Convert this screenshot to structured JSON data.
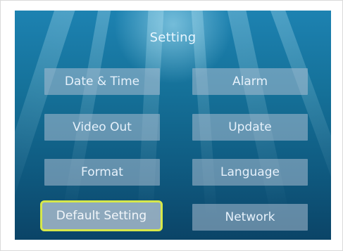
{
  "screen": {
    "title": "Setting"
  },
  "menu": {
    "date_time": "Date & Time",
    "alarm": "Alarm",
    "video_out": "Video Out",
    "update": "Update",
    "format": "Format",
    "language": "Language",
    "default_setting": "Default Setting",
    "network": "Network",
    "selected": "Default Setting"
  },
  "colors": {
    "background_top": "#1d82b1",
    "background_bottom": "#0b4467",
    "button_fill": "#a9bdd0",
    "selection_border": "#d7e84a",
    "text": "#e6f1fb"
  }
}
